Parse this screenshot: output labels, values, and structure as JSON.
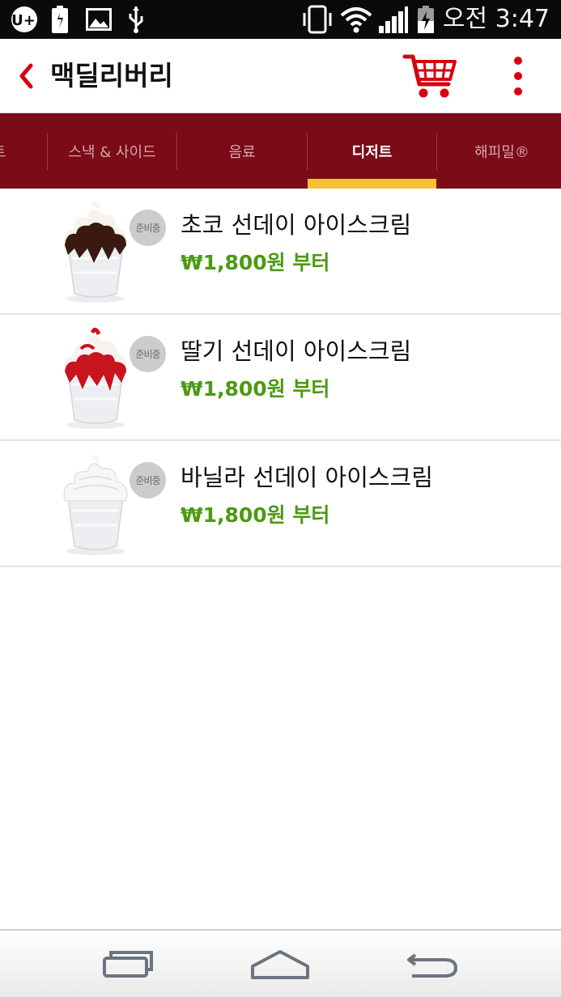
{
  "status_bar": {
    "carrier_logo_text": "U+",
    "time": "오전 3:47",
    "icons": [
      "uplus-logo-icon",
      "battery-full-icon",
      "image-icon",
      "usb-icon",
      "vibrate-phone-icon",
      "wifi-icon",
      "signal-icon",
      "battery-charging-icon"
    ]
  },
  "header": {
    "title": "맥딜리버리",
    "back_icon": "chevron-left-icon",
    "cart_icon": "cart-icon",
    "more_icon": "more-vertical-icon"
  },
  "tabs": [
    {
      "label": "트",
      "active": false
    },
    {
      "label": "스낵 & 사이드",
      "active": false
    },
    {
      "label": "음료",
      "active": false
    },
    {
      "label": "디저트",
      "active": true
    },
    {
      "label": "해피밀®",
      "active": false
    }
  ],
  "menu_items": [
    {
      "name": "초코 선데이 아이스크림",
      "price": "₩1,800원 부터",
      "badge": "준비중",
      "topping": "chocolate"
    },
    {
      "name": "딸기 선데이 아이스크림",
      "price": "₩1,800원 부터",
      "badge": "준비중",
      "topping": "strawberry"
    },
    {
      "name": "바닐라 선데이 아이스크림",
      "price": "₩1,800원 부터",
      "badge": "준비중",
      "topping": "vanilla"
    }
  ],
  "nav_bar": {
    "icons": [
      "recent-apps-icon",
      "home-icon",
      "back-icon"
    ]
  },
  "colors": {
    "brand_red": "#d8000f",
    "tab_bar": "#7a0b17",
    "tab_indicator": "#f6c232",
    "price_green": "#4c9a12"
  }
}
